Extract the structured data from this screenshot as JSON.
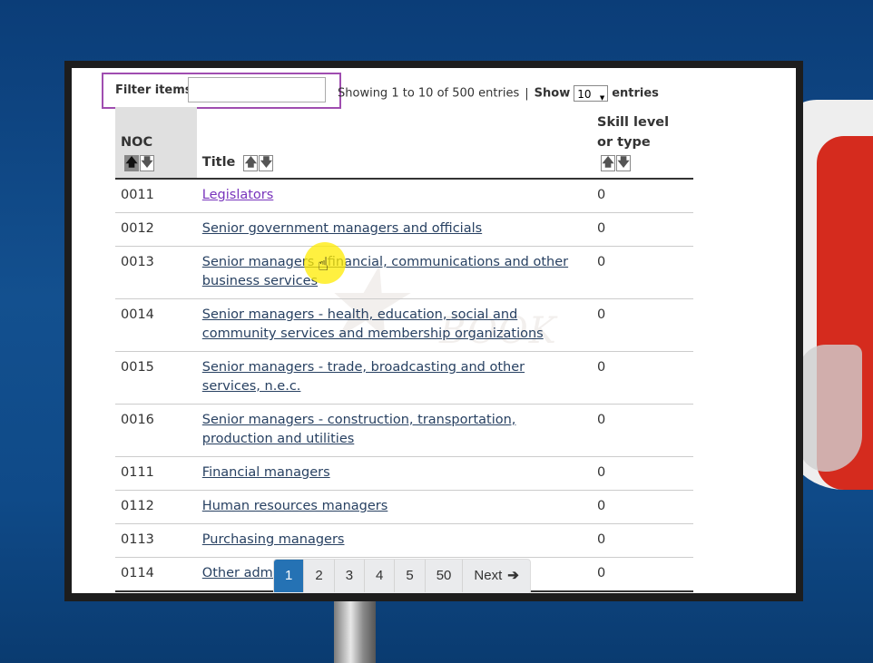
{
  "filter": {
    "label": "Filter items",
    "value": ""
  },
  "info": {
    "showing": "Showing 1 to 10 of 500 entries",
    "show_label": "Show",
    "show_value": "10",
    "entries_label": "entries"
  },
  "columns": [
    {
      "label": "NOC"
    },
    {
      "label": "Title"
    },
    {
      "label": "Skill level or type"
    }
  ],
  "rows": [
    {
      "noc": "0011",
      "title": "Legislators",
      "skill": "0"
    },
    {
      "noc": "0012",
      "title": "Senior government managers and officials",
      "skill": "0"
    },
    {
      "noc": "0013",
      "title": "Senior managers - financial, communications and other business services",
      "skill": "0"
    },
    {
      "noc": "0014",
      "title": "Senior managers - health, education, social and community services and membership organizations",
      "skill": "0"
    },
    {
      "noc": "0015",
      "title": "Senior managers - trade, broadcasting and other services, n.e.c.",
      "skill": "0"
    },
    {
      "noc": "0016",
      "title": "Senior managers - construction, transportation, production and utilities",
      "skill": "0"
    },
    {
      "noc": "0111",
      "title": "Financial managers",
      "skill": "0"
    },
    {
      "noc": "0112",
      "title": "Human resources managers",
      "skill": "0"
    },
    {
      "noc": "0113",
      "title": "Purchasing managers",
      "skill": "0"
    },
    {
      "noc": "0114",
      "title": "Other administrative services managers",
      "skill": "0"
    }
  ],
  "pagination": {
    "pages": [
      "1",
      "2",
      "3",
      "4",
      "5",
      "50"
    ],
    "active": "1",
    "next_label": "Next"
  },
  "watermark": "BOOK",
  "colors": {
    "accent": "#2572b4",
    "link": "#284162",
    "visited": "#7834bc",
    "filter_border": "#a04db0"
  }
}
